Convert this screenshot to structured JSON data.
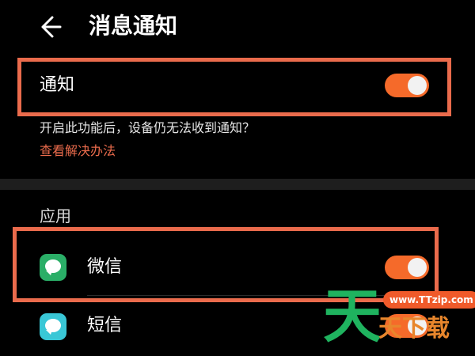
{
  "header": {
    "title": "消息通知",
    "back_icon": "arrow-left-icon"
  },
  "notification": {
    "label": "通知",
    "enabled": true
  },
  "hint": {
    "text": "开启此功能后，设备仍无法收到通知？",
    "link": "查看解决办法"
  },
  "apps_section": {
    "title": "应用",
    "items": [
      {
        "name": "微信",
        "icon": "wechat-icon",
        "enabled": true
      },
      {
        "name": "短信",
        "icon": "sms-icon",
        "enabled": true
      }
    ]
  },
  "watermark": {
    "logo_text": "天",
    "url": "www.TTzip.com",
    "text": "天下载"
  },
  "colors": {
    "accent": "#ea6b4c",
    "toggle_on": "#f56a2a",
    "background": "#000000"
  }
}
